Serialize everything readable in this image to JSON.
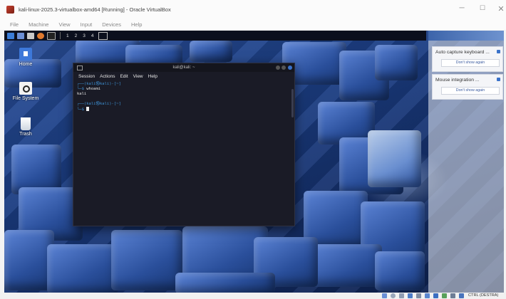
{
  "window": {
    "title": "kali-linux-2025.3-virtualbox-amd64 [Running] - Oracle VirtualBox",
    "controls": {
      "minimize": "─",
      "maximize": "☐",
      "close": "✕"
    }
  },
  "menubar": [
    "File",
    "Machine",
    "View",
    "Input",
    "Devices",
    "Help"
  ],
  "guest_panel": {
    "workspaces": [
      "1",
      "2",
      "3",
      "4"
    ],
    "icons": [
      "kali-menu-icon",
      "blue-window-icon",
      "folder-icon",
      "firefox-icon",
      "terminal-icon"
    ]
  },
  "desktop": {
    "icons": [
      {
        "label": "Home",
        "icon": "home-icon"
      },
      {
        "label": "File System",
        "icon": "drive-icon"
      },
      {
        "label": "Trash",
        "icon": "trash-icon"
      }
    ]
  },
  "terminal": {
    "title": "kali@kali: ~",
    "menu": [
      "Session",
      "Actions",
      "Edit",
      "View",
      "Help"
    ],
    "lines": [
      {
        "prompt": "┌──(kali㉿kali)-[~]"
      },
      {
        "prompt": "└─$",
        "command": "whoami"
      },
      {
        "output": "kali"
      },
      {
        "blank": ""
      },
      {
        "prompt": "┌──(kali㉿kali)-[~]"
      },
      {
        "prompt": "└─$",
        "command": ""
      }
    ]
  },
  "notifications": [
    {
      "title": "Auto capture keyboard ...",
      "button": "Don't show again"
    },
    {
      "title": "Mouse integration ...",
      "button": "Don't show again"
    }
  ],
  "statusbar": {
    "host_key": "CTRL (DESTRA)"
  },
  "colors": {
    "accent": "#3a72c9",
    "terminal_bg": "#1a1b26",
    "prompt": "#3d8fd1"
  }
}
